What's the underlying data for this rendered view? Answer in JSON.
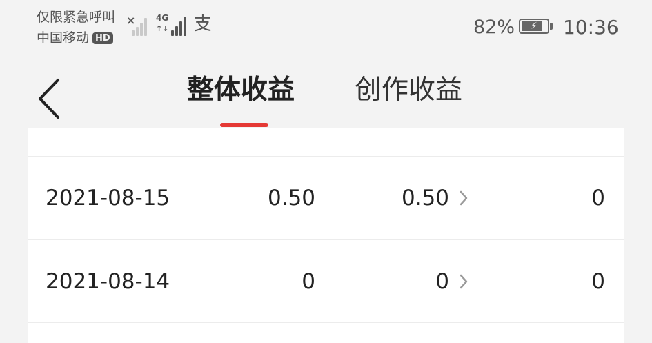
{
  "status_bar": {
    "carrier_line1": "仅限紧急呼叫",
    "carrier_line2": "中国移动",
    "hd_badge": "HD",
    "network_type": "4G",
    "network_arrows": "↑↓",
    "no_sim_mark": "×",
    "battery_percent": "82%",
    "battery_level": 0.82,
    "time": "10:36",
    "pay_icon_glyph": "支"
  },
  "header": {
    "tabs": [
      {
        "label": "整体收益",
        "active": true
      },
      {
        "label": "创作收益",
        "active": false
      }
    ],
    "accent_color": "#e53935"
  },
  "table": {
    "rows": [
      {
        "date": "2021-08-15",
        "total": "0.50",
        "creation": "0.50",
        "other": "0"
      },
      {
        "date": "2021-08-14",
        "total": "0",
        "creation": "0",
        "other": "0"
      }
    ]
  }
}
